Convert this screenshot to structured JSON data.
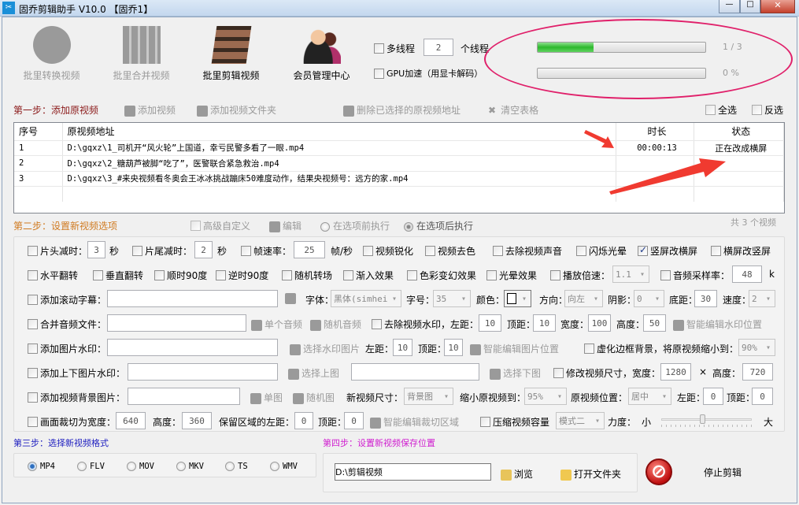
{
  "window": {
    "title": "固乔剪辑助手 V10.0  【固乔1】",
    "controls": [
      "minimize",
      "maximize",
      "close"
    ]
  },
  "toolbar": {
    "items": [
      {
        "label": "批里转换视频",
        "icon": "convert-icon",
        "enabled": false
      },
      {
        "label": "批里合并视频",
        "icon": "merge-icon",
        "enabled": false
      },
      {
        "label": "批里剪辑视频",
        "icon": "film-scissors-icon",
        "enabled": true
      },
      {
        "label": "会员管理中心",
        "icon": "members-icon",
        "enabled": true
      }
    ]
  },
  "threads": {
    "multi_label": "多线程",
    "count": "2",
    "unit": "个线程",
    "gpu_label": "GPU加速（用显卡解码）"
  },
  "progress": {
    "overall_text": "1 / 3",
    "overall_fraction": 0.333,
    "current_text": "0 %",
    "current_fraction": 0
  },
  "step1": {
    "title": "第一步：添加原视频",
    "add_video": "添加视频",
    "add_folder": "添加视频文件夹",
    "delete_selected": "删除已选择的原视频地址",
    "clear_table": "清空表格",
    "select_all": "全选",
    "invert": "反选"
  },
  "table": {
    "headers": [
      "序号",
      "原视频地址",
      "时长",
      "状态"
    ],
    "rows": [
      {
        "no": "1",
        "path": "D:\\gqxz\\1_司机开“风火轮”上国道，幸亏民警多看了一眼.mp4",
        "duration": "00:00:13",
        "status": "正在改成横屏"
      },
      {
        "no": "2",
        "path": "D:\\gqxz\\2_糖葫芦被脚“吃了”，医警联合紧急救治.mp4",
        "duration": "",
        "status": ""
      },
      {
        "no": "3",
        "path": "D:\\gqxz\\3_#来央视频看冬奥会王冰冰挑战蹦床50难度动作，结果央视频号：远方的家.mp4",
        "duration": "",
        "status": ""
      }
    ]
  },
  "step2": {
    "title": "第二步：设置新视频选项",
    "advanced": "高级自定义",
    "edit": "编辑",
    "before": "在选项前执行",
    "after": "在选项后执行",
    "total": "共 3 个视频"
  },
  "opt": {
    "r1": {
      "head": "片头减时：",
      "head_val": "3",
      "sec": "秒",
      "tail": "片尾减时：",
      "tail_val": "2",
      "sec2": "秒",
      "fps": "帧速率：",
      "fps_val": "25",
      "fps_unit": "帧/秒",
      "sharpen": "视频锐化",
      "gray": "视频去色",
      "mute": "去除视频声音",
      "flash": "闪烁光晕",
      "v2h": "竖屏改横屏",
      "h2v": "横屏改竖屏"
    },
    "r2": {
      "hflip": "水平翻转",
      "vflip": "垂直翻转",
      "cw": "顺时90度",
      "ccw": "逆时90度",
      "trans": "随机转场",
      "fadein": "渐入效果",
      "color": "色彩变幻效果",
      "halo": "光晕效果",
      "speed": "播放倍速：",
      "speed_val": "1.1",
      "rate": "音频采样率：",
      "rate_val": "48",
      "rate_unit": "k"
    },
    "r3": {
      "sub": "添加滚动字幕：",
      "font": "字体：",
      "font_val": "黑体(simhei",
      "size": "字号：",
      "size_val": "35",
      "color": "颜色：",
      "dir": "方向：",
      "dir_val": "向左",
      "shadow": "阴影：",
      "shadow_val": "0",
      "bottom": "底距：",
      "bottom_val": "30",
      "spd": "速度：",
      "spd_val": "2"
    },
    "r4": {
      "audio": "合并音频文件：",
      "single": "单个音频",
      "random": "随机音频",
      "wm": "去除视频水印，左距：",
      "l": "10",
      "top": "顶距：",
      "t": "10",
      "w_lbl": "宽度：",
      "w": "100",
      "h_lbl": "高度：",
      "h": "50",
      "smart": "智能编辑水印位置"
    },
    "r5": {
      "img": "添加图片水印：",
      "pick": "选择水印图片",
      "left": "左距：",
      "l": "10",
      "top": "顶距：",
      "t": "10",
      "smart": "智能编辑图片位置",
      "blur": "虚化边框背景，将原视频缩小到：",
      "blur_val": "90%"
    },
    "r6": {
      "tb": "添加上下图片水印：",
      "up": "选择上图",
      "down": "选择下图",
      "resize": "修改视频尺寸，宽度：",
      "w": "1280",
      "x": "×",
      "h_lbl": "高度：",
      "h": "720"
    },
    "r7": {
      "bg": "添加视频背景图片：",
      "single": "单图",
      "random": "随机图",
      "size": "新视频尺寸：",
      "size_val": "背景图",
      "shrink": "缩小原视频到：",
      "shrink_val": "95%",
      "pos": "原视频位置：",
      "pos_val": "居中",
      "left": "左距：",
      "l": "0",
      "top": "顶距：",
      "t": "0"
    },
    "r8": {
      "crop": "画面裁切为宽度：",
      "w": "640",
      "h_lbl": "高度：",
      "h": "360",
      "keep": "保留区域的左距：",
      "l": "0",
      "top": "顶距：",
      "t": "0",
      "smart": "智能编辑裁切区域",
      "compress": "压缩视频容量",
      "mode": "模式二",
      "force": "力度：",
      "small": "小",
      "big": "大",
      "force_level": 0.45
    }
  },
  "step3": {
    "title": "第三步：选择新视频格式",
    "formats": [
      "MP4",
      "FLV",
      "MOV",
      "MKV",
      "TS",
      "WMV"
    ],
    "selected": "MP4"
  },
  "step4": {
    "title": "第四步：设置新视频保存位置",
    "path": "D:\\剪辑视频",
    "browse": "浏览",
    "open": "打开文件夹",
    "stop": "停止剪辑"
  },
  "colors": {
    "step1": "#8b1a1a",
    "step2": "#d07a20",
    "step3": "#2020c0",
    "step4": "#d020d0",
    "annotation": "#e0206a",
    "arrow": "#f03a30"
  }
}
